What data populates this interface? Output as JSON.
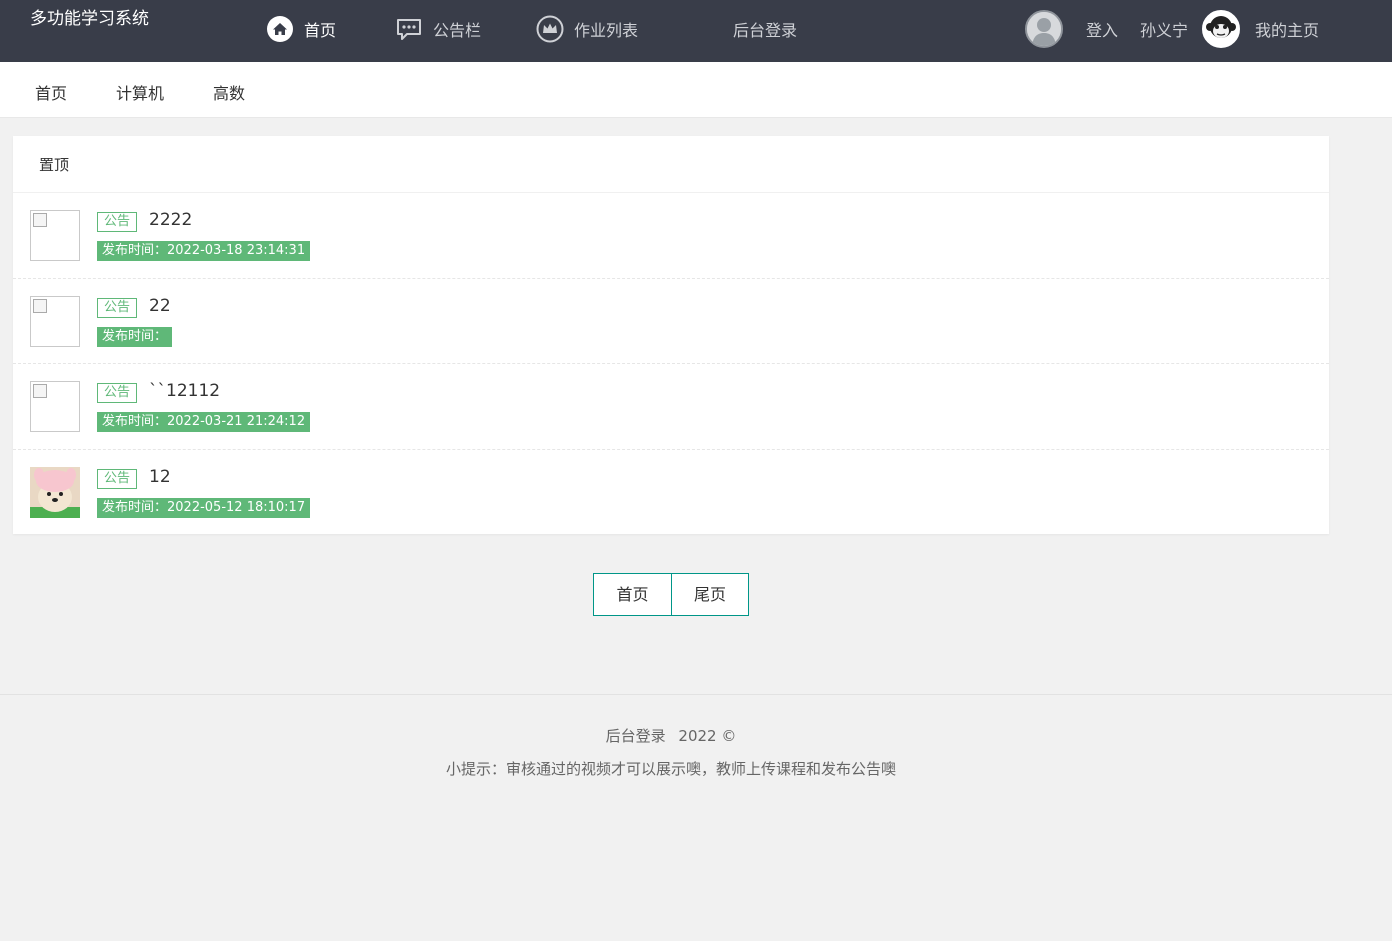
{
  "header": {
    "brand": "多功能学习系统",
    "nav": [
      {
        "label": "首页",
        "icon": "home-icon"
      },
      {
        "label": "公告栏",
        "icon": "message-icon"
      },
      {
        "label": "作业列表",
        "icon": "crown-icon"
      },
      {
        "label": "后台登录",
        "icon": ""
      }
    ],
    "login_label": "登入",
    "username": "孙义宁",
    "my_home_label": "我的主页"
  },
  "subnav": {
    "items": [
      "首页",
      "计算机",
      "高数"
    ]
  },
  "list": {
    "heading": "置顶",
    "tag_label": "公告",
    "time_prefix": "发布时间：",
    "items": [
      {
        "title": "2222",
        "time": "2022-03-18 23:14:31",
        "thumb": "broken-image"
      },
      {
        "title": "22",
        "time": "",
        "thumb": "broken-image"
      },
      {
        "title": "``12112",
        "time": "2022-03-21 21:24:12",
        "thumb": "broken-image"
      },
      {
        "title": "12",
        "time": "2022-05-12 18:10:17",
        "thumb": "dog-photo"
      }
    ]
  },
  "pager": {
    "first_label": "首页",
    "last_label": "尾页"
  },
  "footer": {
    "admin_login": "后台登录",
    "copyright": "2022 ©",
    "tip": "小提示：审核通过的视频才可以展示噢，教师上传课程和发布公告噢"
  },
  "colors": {
    "header_bg": "#393d49",
    "accent_green": "#5fb878",
    "pager_border": "#009688"
  }
}
